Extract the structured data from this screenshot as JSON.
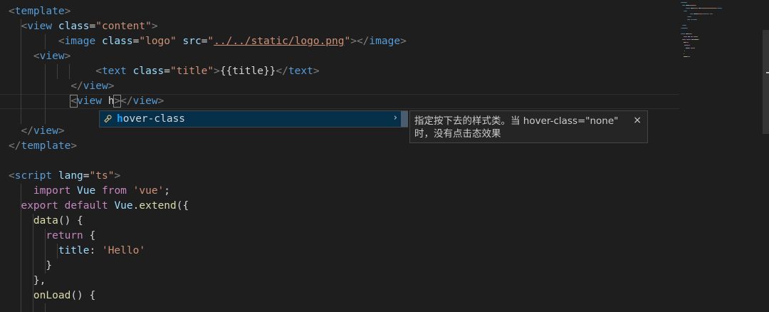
{
  "editor": {
    "language": "vue",
    "lines": [
      {
        "indent_guides": [],
        "tokens": [
          {
            "t": "<",
            "c": "t-punct"
          },
          {
            "t": "template",
            "c": "t-tag"
          },
          {
            "t": ">",
            "c": "t-punct"
          }
        ]
      },
      {
        "indent_guides": [
          1
        ],
        "tokens": [
          {
            "t": "  ",
            "c": "t-plain"
          },
          {
            "t": "<",
            "c": "t-punct"
          },
          {
            "t": "view",
            "c": "t-tag"
          },
          {
            "t": " ",
            "c": "t-plain"
          },
          {
            "t": "class",
            "c": "t-attr"
          },
          {
            "t": "=",
            "c": "t-plain"
          },
          {
            "t": "\"content\"",
            "c": "t-str"
          },
          {
            "t": ">",
            "c": "t-punct"
          }
        ]
      },
      {
        "indent_guides": [
          1,
          3
        ],
        "tokens": [
          {
            "t": "        ",
            "c": "t-plain"
          },
          {
            "t": "<",
            "c": "t-punct"
          },
          {
            "t": "image",
            "c": "t-tag"
          },
          {
            "t": " ",
            "c": "t-plain"
          },
          {
            "t": "class",
            "c": "t-attr"
          },
          {
            "t": "=",
            "c": "t-plain"
          },
          {
            "t": "\"logo\"",
            "c": "t-str"
          },
          {
            "t": " ",
            "c": "t-plain"
          },
          {
            "t": "src",
            "c": "t-attr"
          },
          {
            "t": "=",
            "c": "t-plain"
          },
          {
            "t": "\"",
            "c": "t-str"
          },
          {
            "t": "../../static/logo.png",
            "c": "t-link"
          },
          {
            "t": "\"",
            "c": "t-str"
          },
          {
            "t": "></",
            "c": "t-punct"
          },
          {
            "t": "image",
            "c": "t-tag"
          },
          {
            "t": ">",
            "c": "t-punct"
          }
        ]
      },
      {
        "indent_guides": [
          1
        ],
        "tokens": [
          {
            "t": "    ",
            "c": "t-plain"
          },
          {
            "t": "<",
            "c": "t-punct"
          },
          {
            "t": "view",
            "c": "t-tag"
          },
          {
            "t": ">",
            "c": "t-punct"
          }
        ]
      },
      {
        "indent_guides": [
          1,
          3,
          4,
          5
        ],
        "tokens": [
          {
            "t": "              ",
            "c": "t-plain"
          },
          {
            "t": "<",
            "c": "t-punct"
          },
          {
            "t": "text",
            "c": "t-tag"
          },
          {
            "t": " ",
            "c": "t-plain"
          },
          {
            "t": "class",
            "c": "t-attr"
          },
          {
            "t": "=",
            "c": "t-plain"
          },
          {
            "t": "\"title\"",
            "c": "t-str"
          },
          {
            "t": ">",
            "c": "t-punct"
          },
          {
            "t": "{{title}}",
            "c": "t-plain"
          },
          {
            "t": "</",
            "c": "t-punct"
          },
          {
            "t": "text",
            "c": "t-tag"
          },
          {
            "t": ">",
            "c": "t-punct"
          }
        ]
      },
      {
        "indent_guides": [
          1,
          3
        ],
        "tokens": [
          {
            "t": "          ",
            "c": "t-plain"
          },
          {
            "t": "</",
            "c": "t-punct"
          },
          {
            "t": "view",
            "c": "t-tag"
          },
          {
            "t": ">",
            "c": "t-punct"
          }
        ]
      },
      {
        "indent_guides": [
          1,
          3
        ],
        "current": true,
        "tokens": [
          {
            "t": "          ",
            "c": "t-plain"
          },
          {
            "t": "<",
            "c": "t-punct bracket-box"
          },
          {
            "t": "view",
            "c": "t-tag"
          },
          {
            "t": " ",
            "c": "t-plain"
          },
          {
            "t": "h",
            "c": "t-plain"
          },
          {
            "t": ">",
            "c": "t-punct bracket-box"
          },
          {
            "t": "</",
            "c": "t-punct"
          },
          {
            "t": "view",
            "c": "t-tag"
          },
          {
            "t": ">",
            "c": "t-punct"
          }
        ]
      },
      {
        "indent_guides": [
          1,
          3
        ],
        "tokens": []
      },
      {
        "indent_guides": [],
        "tokens": [
          {
            "t": "  ",
            "c": "t-plain"
          },
          {
            "t": "</",
            "c": "t-punct"
          },
          {
            "t": "view",
            "c": "t-tag"
          },
          {
            "t": ">",
            "c": "t-punct"
          }
        ]
      },
      {
        "indent_guides": [],
        "tokens": [
          {
            "t": "</",
            "c": "t-punct"
          },
          {
            "t": "template",
            "c": "t-tag"
          },
          {
            "t": ">",
            "c": "t-punct"
          }
        ]
      },
      {
        "indent_guides": [],
        "tokens": []
      },
      {
        "indent_guides": [],
        "tokens": [
          {
            "t": "<",
            "c": "t-punct"
          },
          {
            "t": "script",
            "c": "t-tag"
          },
          {
            "t": " ",
            "c": "t-plain"
          },
          {
            "t": "lang",
            "c": "t-attr"
          },
          {
            "t": "=",
            "c": "t-plain"
          },
          {
            "t": "\"ts\"",
            "c": "t-str"
          },
          {
            "t": ">",
            "c": "t-punct"
          }
        ]
      },
      {
        "indent_guides": [
          1
        ],
        "tokens": [
          {
            "t": "    ",
            "c": "t-plain"
          },
          {
            "t": "import",
            "c": "t-kw"
          },
          {
            "t": " ",
            "c": "t-plain"
          },
          {
            "t": "Vue",
            "c": "t-prop"
          },
          {
            "t": " ",
            "c": "t-plain"
          },
          {
            "t": "from",
            "c": "t-kw"
          },
          {
            "t": " ",
            "c": "t-plain"
          },
          {
            "t": "'vue'",
            "c": "t-str"
          },
          {
            "t": ";",
            "c": "t-plain"
          }
        ]
      },
      {
        "indent_guides": [
          1
        ],
        "tokens": [
          {
            "t": "  ",
            "c": "t-plain"
          },
          {
            "t": "export",
            "c": "t-kw"
          },
          {
            "t": " ",
            "c": "t-plain"
          },
          {
            "t": "default",
            "c": "t-kw"
          },
          {
            "t": " ",
            "c": "t-plain"
          },
          {
            "t": "Vue",
            "c": "t-prop"
          },
          {
            "t": ".",
            "c": "t-plain"
          },
          {
            "t": "extend",
            "c": "t-fn"
          },
          {
            "t": "({",
            "c": "t-plain"
          }
        ]
      },
      {
        "indent_guides": [
          1,
          2
        ],
        "tokens": [
          {
            "t": "    ",
            "c": "t-plain"
          },
          {
            "t": "data",
            "c": "t-fn"
          },
          {
            "t": "() {",
            "c": "t-plain"
          }
        ]
      },
      {
        "indent_guides": [
          1,
          2,
          3
        ],
        "tokens": [
          {
            "t": "      ",
            "c": "t-plain"
          },
          {
            "t": "return",
            "c": "t-kw"
          },
          {
            "t": " {",
            "c": "t-plain"
          }
        ]
      },
      {
        "indent_guides": [
          1,
          2,
          3,
          4
        ],
        "tokens": [
          {
            "t": "        ",
            "c": "t-plain"
          },
          {
            "t": "title",
            "c": "t-prop"
          },
          {
            "t": ": ",
            "c": "t-plain"
          },
          {
            "t": "'Hello'",
            "c": "t-str"
          }
        ]
      },
      {
        "indent_guides": [
          1,
          2,
          3
        ],
        "tokens": [
          {
            "t": "      ",
            "c": "t-plain"
          },
          {
            "t": "}",
            "c": "t-plain"
          }
        ]
      },
      {
        "indent_guides": [
          1,
          2
        ],
        "tokens": [
          {
            "t": "    ",
            "c": "t-plain"
          },
          {
            "t": "},",
            "c": "t-plain"
          }
        ]
      },
      {
        "indent_guides": [
          1,
          2
        ],
        "tokens": [
          {
            "t": "    ",
            "c": "t-plain"
          },
          {
            "t": "onLoad",
            "c": "t-fn"
          },
          {
            "t": "() {",
            "c": "t-plain"
          }
        ]
      },
      {
        "indent_guides": [
          1,
          2,
          3
        ],
        "tokens": []
      }
    ]
  },
  "suggestion": {
    "icon": "property-icon",
    "match": "h",
    "rest": "over-class",
    "chevron": "›"
  },
  "details": {
    "text": "指定按下去的样式类。当 hover-class=\"none\" 时，没有点击态效果",
    "close": "×"
  },
  "colors": {
    "background": "#1e1e1e",
    "suggest_selected": "#062f4a",
    "match_highlight": "#18a3ff",
    "tag": "#569cd6",
    "attribute": "#9cdcfe",
    "string": "#ce9178"
  }
}
